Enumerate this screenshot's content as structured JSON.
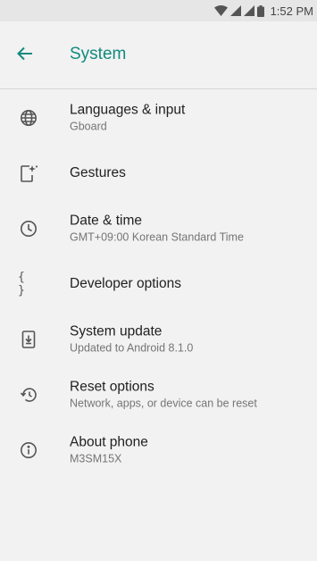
{
  "status_bar": {
    "time": "1:52 PM"
  },
  "header": {
    "title": "System"
  },
  "items": [
    {
      "title": "Languages & input",
      "subtitle": "Gboard",
      "icon": "globe-icon"
    },
    {
      "title": "Gestures",
      "subtitle": "",
      "icon": "gestures-icon"
    },
    {
      "title": "Date & time",
      "subtitle": "GMT+09:00 Korean Standard Time",
      "icon": "clock-icon"
    },
    {
      "title": "Developer options",
      "subtitle": "",
      "icon": "braces-icon",
      "glyph": "{ }"
    },
    {
      "title": "System update",
      "subtitle": "Updated to Android 8.1.0",
      "icon": "system-update-icon"
    },
    {
      "title": "Reset options",
      "subtitle": "Network, apps, or device can be reset",
      "icon": "restore-icon"
    },
    {
      "title": "About phone",
      "subtitle": "M3SM15X",
      "icon": "info-icon"
    }
  ],
  "colors": {
    "accent": "#128a7f",
    "background": "#f2f2f2"
  }
}
